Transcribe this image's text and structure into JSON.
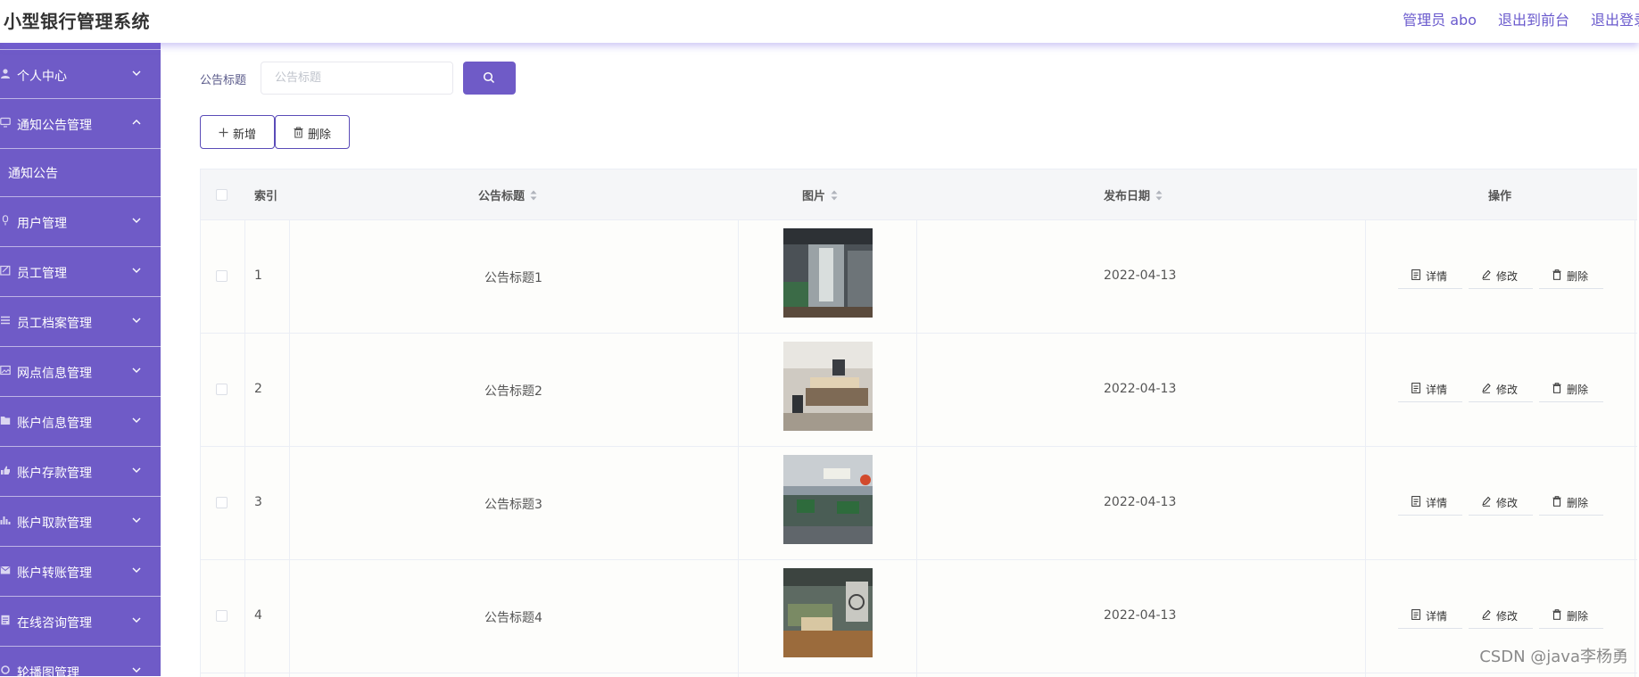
{
  "header": {
    "title": "小型银行管理系统",
    "admin": "管理员 abo",
    "to_front": "退出到前台",
    "logout": "退出登录"
  },
  "sidebar": {
    "items": [
      {
        "label": "个人中心",
        "icon": "user-icon",
        "expanded": false
      },
      {
        "label": "通知公告管理",
        "icon": "monitor-icon",
        "expanded": true,
        "children": [
          "通知公告"
        ]
      },
      {
        "label": "用户管理",
        "icon": "mic-icon",
        "expanded": false
      },
      {
        "label": "员工管理",
        "icon": "edit-icon",
        "expanded": false
      },
      {
        "label": "员工档案管理",
        "icon": "list-icon",
        "expanded": false
      },
      {
        "label": "网点信息管理",
        "icon": "picture-icon",
        "expanded": false
      },
      {
        "label": "账户信息管理",
        "icon": "folder-icon",
        "expanded": false
      },
      {
        "label": "账户存款管理",
        "icon": "thumb-icon",
        "expanded": false
      },
      {
        "label": "账户取款管理",
        "icon": "chart-icon",
        "expanded": false
      },
      {
        "label": "账户转账管理",
        "icon": "mail-icon",
        "expanded": false
      },
      {
        "label": "在线咨询管理",
        "icon": "document-icon",
        "expanded": false
      },
      {
        "label": "轮播图管理",
        "icon": "setting-icon",
        "expanded": false
      }
    ]
  },
  "search": {
    "label": "公告标题",
    "placeholder": "公告标题",
    "value": ""
  },
  "toolbar": {
    "add_label": "新增",
    "delete_label": "删除"
  },
  "table": {
    "headers": {
      "index": "索引",
      "title": "公告标题",
      "image": "图片",
      "date": "发布日期",
      "ops": "操作"
    },
    "rows": [
      {
        "index": "1",
        "title": "公告标题1",
        "date": "2022-04-13"
      },
      {
        "index": "2",
        "title": "公告标题2",
        "date": "2022-04-13"
      },
      {
        "index": "3",
        "title": "公告标题3",
        "date": "2022-04-13"
      },
      {
        "index": "4",
        "title": "公告标题4",
        "date": "2022-04-13"
      }
    ],
    "ops": {
      "detail": "详情",
      "edit": "修改",
      "delete": "删除"
    }
  },
  "watermark": "CSDN @java李杨勇",
  "colors": {
    "accent": "#6f5bc7",
    "link": "#6a5acd",
    "border": "#ebeef5"
  }
}
